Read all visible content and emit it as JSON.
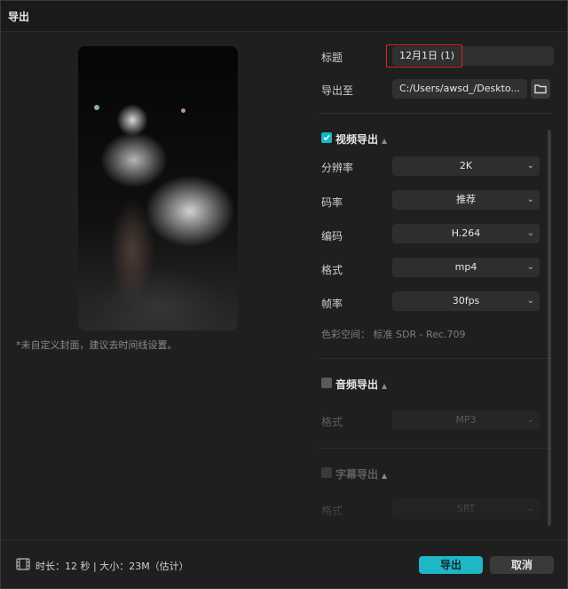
{
  "window": {
    "title": "导出"
  },
  "preview": {
    "cover_note": "*未自定义封面，建议去时间线设置。"
  },
  "settings": {
    "title_label": "标题",
    "title_value": "12月1日 (1)",
    "export_to_label": "导出至",
    "export_path": "C:/Users/awsd_/Deskto..."
  },
  "video": {
    "section_label": "视频导出",
    "checked": true,
    "rows": [
      {
        "label": "分辨率",
        "value": "2K"
      },
      {
        "label": "码率",
        "value": "推荐"
      },
      {
        "label": "编码",
        "value": "H.264"
      },
      {
        "label": "格式",
        "value": "mp4"
      },
      {
        "label": "帧率",
        "value": "30fps"
      }
    ],
    "color_space": "色彩空间：  标准 SDR - Rec.709"
  },
  "audio": {
    "section_label": "音频导出",
    "checked": false,
    "format_label": "格式",
    "format_value": "MP3"
  },
  "subtitle": {
    "section_label": "字幕导出",
    "checked": false,
    "format_label": "格式",
    "format_value": "SRT"
  },
  "footer": {
    "info": "时长：12 秒 | 大小：23M（估计）",
    "export_button": "导出",
    "cancel_button": "取消"
  },
  "colors": {
    "accent": "#1fb7c6",
    "highlight_border": "#e02424"
  }
}
